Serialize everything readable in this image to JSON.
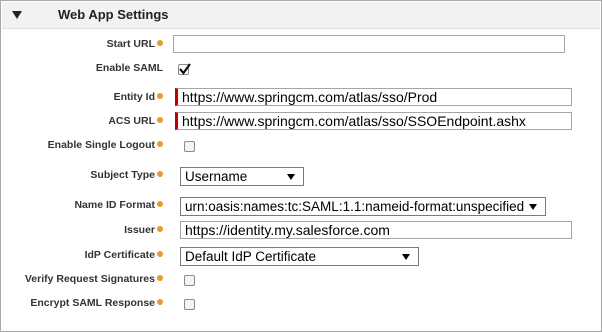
{
  "section": {
    "title": "Web App Settings"
  },
  "fields": {
    "start_url": {
      "label": "Start URL",
      "value": ""
    },
    "enable_saml": {
      "label": "Enable SAML",
      "checked": true
    },
    "entity_id": {
      "label": "Entity Id",
      "value": "https://www.springcm.com/atlas/sso/Prod"
    },
    "acs_url": {
      "label": "ACS URL",
      "value": "https://www.springcm.com/atlas/sso/SSOEndpoint.ashx"
    },
    "enable_single_logout": {
      "label": "Enable Single Logout",
      "checked": false
    },
    "subject_type": {
      "label": "Subject Type",
      "selected": "Username"
    },
    "name_id_format": {
      "label": "Name ID Format",
      "selected": "urn:oasis:names:tc:SAML:1.1:nameid-format:unspecified"
    },
    "issuer": {
      "label": "Issuer",
      "value": "https://identity.my.salesforce.com"
    },
    "idp_certificate": {
      "label": "IdP Certificate",
      "selected": "Default IdP Certificate"
    },
    "verify_request_signatures": {
      "label": "Verify Request Signatures",
      "checked": false
    },
    "encrypt_saml_response": {
      "label": "Encrypt SAML Response",
      "checked": false
    }
  },
  "colors": {
    "required_bar": "#c00000",
    "help_icon": "#e89a2a",
    "header_bg": "#f2f2f2"
  }
}
